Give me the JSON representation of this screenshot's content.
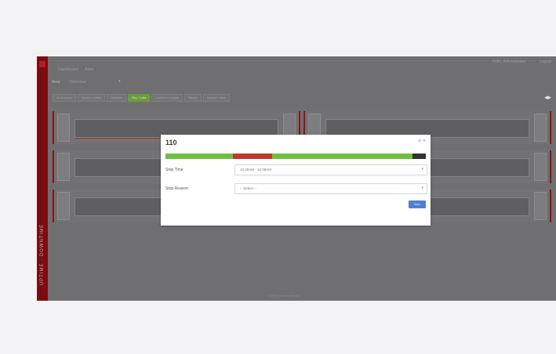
{
  "header": {
    "nav": [
      "Dashboard",
      "Area"
    ],
    "user": "Hello, Administrator",
    "logout": "Logout"
  },
  "sidebar": {
    "label": "UPTIME · DOWNTIME"
  },
  "filter": {
    "label": "Area",
    "value": "Overview"
  },
  "tabs": [
    "All Machines",
    "Machine Activity",
    "Utilization",
    "Stop Codes",
    "Downtime Analysis",
    "Reports",
    "Machine Status"
  ],
  "active_tab_index": 3,
  "footer": "© 2021 Line Surveillance",
  "modal": {
    "title": "110",
    "stop_time_label": "Stop Time",
    "stop_time_value": "10:30AM - 10:38AM",
    "stop_reason_label": "Stop Reason",
    "stop_reason_placeholder": "-- Select --",
    "save_label": "Save",
    "timeline_colors": {
      "running": "#6fbf3f",
      "stopped": "#c0392b",
      "offline": "#333333"
    }
  }
}
